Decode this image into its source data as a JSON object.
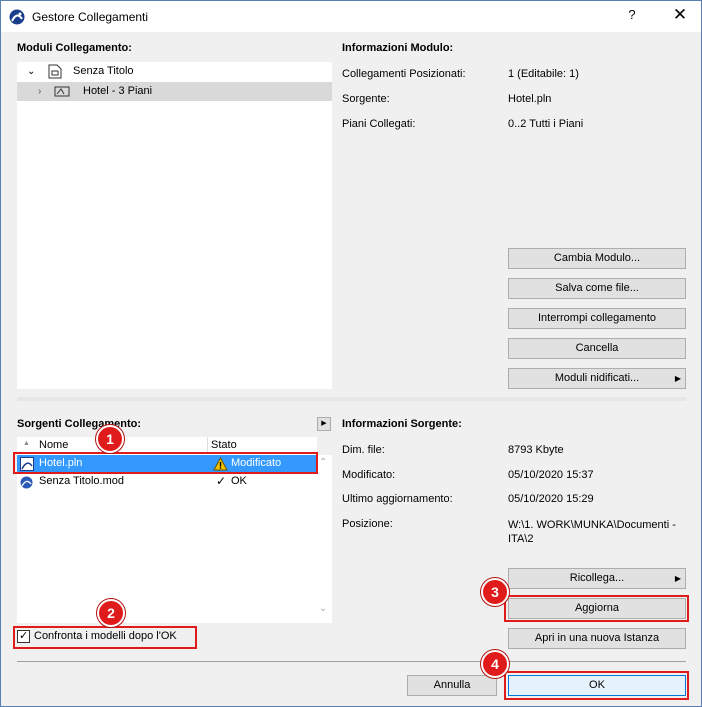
{
  "window": {
    "title": "Gestore Collegamenti",
    "help_label": "?",
    "close_label": "✕"
  },
  "modules": {
    "heading": "Moduli Collegamento:",
    "items": [
      {
        "label": "Senza Titolo",
        "expanded": true
      },
      {
        "label": "Hotel - 3 Piani",
        "expanded": false,
        "selected": true
      }
    ]
  },
  "module_info": {
    "heading": "Informazioni Modulo:",
    "rows": [
      {
        "label": "Collegamenti Posizionati:",
        "value": "1 (Editabile: 1)"
      },
      {
        "label": "Sorgente:",
        "value": "Hotel.pln"
      },
      {
        "label": "Piani Collegati:",
        "value": "0..2 Tutti i Piani"
      }
    ],
    "buttons": {
      "change": "Cambia Modulo...",
      "save": "Salva come file...",
      "break": "Interrompi collegamento",
      "delete": "Cancella",
      "nested": "Moduli nidificati..."
    }
  },
  "sources": {
    "heading": "Sorgenti Collegamento:",
    "col_name": "Nome",
    "col_status": "Stato",
    "rows": [
      {
        "name": "Hotel.pln",
        "status": "Modificato",
        "selected": true
      },
      {
        "name": "Senza Titolo.mod",
        "status": "OK",
        "selected": false
      }
    ],
    "checkbox_label": "Confronta i modelli dopo l'OK",
    "checkbox_checked": true
  },
  "source_info": {
    "heading": "Informazioni Sorgente:",
    "rows": [
      {
        "label": "Dim. file:",
        "value": "8793 Kbyte"
      },
      {
        "label": "Modificato:",
        "value": "05/10/2020 15:37"
      },
      {
        "label": "Ultimo aggiornamento:",
        "value": "05/10/2020 15:29"
      },
      {
        "label": "Posizione:",
        "value": "W:\\1. WORK\\MUNKA\\Documenti - ITA\\2"
      }
    ],
    "buttons": {
      "relink": "Ricollega...",
      "update": "Aggiorna",
      "open_new": "Apri in una nuova Istanza"
    }
  },
  "footer": {
    "cancel": "Annulla",
    "ok": "OK"
  },
  "callouts": [
    "1",
    "2",
    "3",
    "4"
  ],
  "colors": {
    "accent_red": "#e01b1b",
    "selection_blue": "#3399ff",
    "warning_yellow": "#f5c400"
  }
}
